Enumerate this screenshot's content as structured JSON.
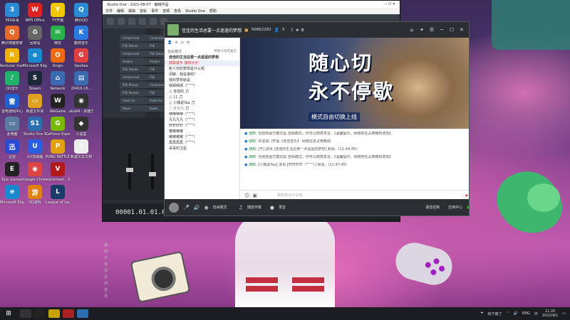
{
  "desktop_icons": [
    {
      "label": "360杀毒",
      "color": "#2a8ad6",
      "glyph": "3"
    },
    {
      "label": "腾讯电脑管家",
      "color": "#e56a2a",
      "glyph": "Q"
    },
    {
      "label": "Rockstar Games",
      "color": "#f0b000",
      "glyph": "R"
    },
    {
      "label": "QQ音乐",
      "color": "#20b26a",
      "glyph": "♪"
    },
    {
      "label": "雷电游戏中心",
      "color": "#2060d0",
      "glyph": "雷"
    },
    {
      "label": "此电脑",
      "color": "#5a7aa0",
      "glyph": "▭"
    },
    {
      "label": "迅雷",
      "color": "#2a4ad0",
      "glyph": "迅"
    },
    {
      "label": "Epic Games",
      "color": "#222",
      "glyph": "E"
    },
    {
      "label": "Microsoft Edge",
      "color": "#1a8ad0",
      "glyph": "e"
    },
    {
      "label": "WPS Office",
      "color": "#d22",
      "glyph": "W"
    },
    {
      "label": "回收站",
      "color": "#666",
      "glyph": "♻"
    },
    {
      "label": "Microsoft Edge",
      "color": "#1a8ad0",
      "glyph": "e"
    },
    {
      "label": "Steam",
      "color": "#1b2838",
      "glyph": "S"
    },
    {
      "label": "新建文件夹",
      "color": "#e0a020",
      "glyph": "▭"
    },
    {
      "label": "Studio One 5",
      "color": "#2b6fb0",
      "glyph": "S1"
    },
    {
      "label": "UU加速器",
      "color": "#2a60e0",
      "glyph": "U"
    },
    {
      "label": "Google Chrome",
      "color": "#d44",
      "glyph": "◉"
    },
    {
      "label": "QQ游戏",
      "color": "#e08010",
      "glyph": "游"
    },
    {
      "label": "YY开播",
      "color": "#f0c800",
      "glyph": "Y"
    },
    {
      "label": "微信",
      "color": "#2ab24a",
      "glyph": "✉"
    },
    {
      "label": "Origin",
      "color": "#f06a10",
      "glyph": "O"
    },
    {
      "label": "Network",
      "color": "#3a6ab0",
      "glyph": "⌂"
    },
    {
      "label": "WeGame",
      "color": "#222",
      "glyph": "W"
    },
    {
      "label": "GeForce Experience",
      "color": "#76b900",
      "glyph": "G"
    },
    {
      "label": "PUBG BATTLEGR...",
      "color": "#e0a010",
      "glyph": "P"
    },
    {
      "label": "voicemeet.. 快捷方式",
      "color": "#b01a1a",
      "glyph": "V"
    },
    {
      "label": "League of Legends",
      "color": "#1a3a6a",
      "glyph": "L"
    },
    {
      "label": "腾讯QQ",
      "color": "#2a8ad6",
      "glyph": "Q"
    },
    {
      "label": "酷狗音乐",
      "color": "#2a7ae0",
      "glyph": "K"
    },
    {
      "label": "GeeSee",
      "color": "#e04040",
      "glyph": "G"
    },
    {
      "label": "20416-16...",
      "color": "#3a6ab0",
      "glyph": "▤"
    },
    {
      "label": "obs64 - 快捷方式",
      "color": "#333",
      "glyph": "◉"
    },
    {
      "label": "小黑盒",
      "color": "#333",
      "glyph": "◆"
    },
    {
      "label": "新建文本文档",
      "color": "#eee",
      "glyph": "▯"
    }
  ],
  "studio_one": {
    "title": "Studio One - 2021-08-07 · 编辑作品",
    "menu": [
      "文件",
      "编辑",
      "歌曲",
      "音轨",
      "事件",
      "音频",
      "查看",
      "Studio One",
      "帮助"
    ],
    "tracks": [
      "Compressor",
      "FSE Stereo",
      "Compressor",
      "Ampire",
      "FSE Stereo",
      "Compressor",
      "FSE Phaser",
      "FSE Reverb",
      "Fresh Air",
      "Room"
    ],
    "tracks_b": [
      "Compressor",
      "FSE Stereo",
      "FSE Delay",
      "Ampire",
      "FSE Stereo",
      "FSE Phaser",
      "Compressor",
      "FSE Chorus",
      "Fresh Air",
      "Room"
    ],
    "vtabs": [
      "编",
      "辑",
      "乐",
      "谱",
      "混",
      "音",
      "浏",
      "览",
      "页"
    ],
    "time": "00001.01.01.00"
  },
  "yy": {
    "title": "佳佳的生活总要一点遥遥的梦想",
    "room_id": "50862282",
    "viewers": "5",
    "banner_line1": "随心切",
    "banner_line2": "永不停歇",
    "banner_sub": "模式自由切换上线",
    "side_tools": [
      "自由模式",
      "所有人均可发言"
    ],
    "channel_list": [
      {
        "text": "佳佳的生活总要一点遥遥的梦想",
        "cls": "",
        "bold": true
      },
      {
        "text": "获取歌手  接待大厅",
        "cls": "red sel"
      },
      {
        "text": "新人你的梦想是什么呢",
        "cls": ""
      },
      {
        "text": "闲聊：我是谁呢？",
        "cls": ""
      },
      {
        "text": "我的梦想就是",
        "cls": ""
      },
      {
        "text": "晴晴晴晴（\"︶\"）",
        "cls": ""
      },
      {
        "text": "  ♫ 佳佳的 🎵",
        "cls": ""
      },
      {
        "text": "    ♫ 11 🎵",
        "cls": ""
      },
      {
        "text": "    ♫ 小偶说Yaa 🎵",
        "cls": ""
      },
      {
        "text": "    ♫ 麦克风 🎵",
        "cls": "gray"
      },
      {
        "text": "咿咿咿咿（\"︶\"）",
        "cls": ""
      },
      {
        "text": "凡凡凡凡（\"︶\"）",
        "cls": ""
      },
      {
        "text": "轩轩轩轩（\"︶\"）",
        "cls": ""
      },
      {
        "text": "嘟嘟嘟嘟",
        "cls": ""
      },
      {
        "text": "嘟嘟嘟嘟（\"︶\"）",
        "cls": ""
      },
      {
        "text": "再再再再（\"︶\"）",
        "cls": ""
      },
      {
        "text": "哥哥的卫星",
        "cls": ""
      }
    ],
    "messages": [
      {
        "tag": "通知:",
        "body": "当前房屋已模式是 自由模式，你可以随意发言。【温馨提示，网络存在占用略有增加】"
      },
      {
        "tag": "通知:",
        "body": "欢迎进门开黑【佳佳音乐】 网络信息占用略增。"
      },
      {
        "tag": "通知:",
        "body": "[不] 进出 [佳佳的生活总要一点遥遥的梦想] 频道。(11:44:45)"
      },
      {
        "tag": "通知:",
        "body": "当前房屋已模式是 自由模式，你可以随意发言。【温馨提示，网络存在占用略有增加】"
      },
      {
        "tag": "通知:",
        "body": "[小偶说Yaa] 进出 [轩轩轩轩（\"︶\"）] 频道。(11:47:45)"
      }
    ],
    "input_placeholder": "我想说点什么吧...",
    "bottom": [
      "自由模式",
      "播放伴奏",
      "录音",
      "语音控制",
      "应用中心"
    ]
  },
  "taskbar": {
    "weather": "快下雨了",
    "ime": "ENG",
    "ime2": "中",
    "time": "11:20",
    "date": "2022/4/1"
  }
}
